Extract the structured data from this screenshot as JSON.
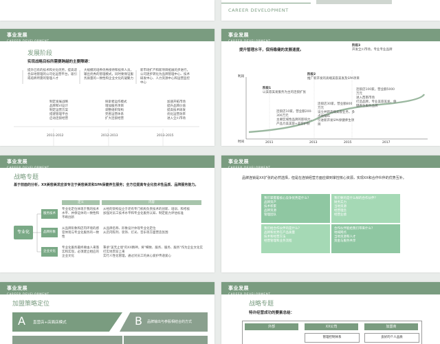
{
  "slide0": {
    "header_en": "CAREER DEVELOPMENT"
  },
  "common": {
    "title": "事业发展",
    "subtitle": "CAREER DEVELOPMENT"
  },
  "slide1": {
    "heading": "发展阶段",
    "intro": "实现战略目标所需要跨越的主要障碍：",
    "cols": [
      {
        "text": "提升已有的技术和文化优势，提高适合异地管理的公司化运营平台，吸引或培养所需的管理人才",
        "items": [
          "制定发展战略",
          "品牌和VI设计",
          "制定运营方案",
          "搭建管理平台",
          "启动连锁经营"
        ],
        "year": "2011-2012"
      },
      {
        "text": "大规模的培养优秀接待和技师人员，输出优秀的管理模式，同时要保证服务质量的一致性和企业文化的凝聚力",
        "items": [
          "探索者运作模式",
          "增加服务项目",
          "调整组织架构",
          "完善运营体系",
          "扩大连锁经营"
        ],
        "year": "2012-2013"
      },
      {
        "text": "新市场扩产和新项目拓展的步进行，公司逐步转化为品牌管理中心、技术研发中心、人力资源中心和运营监控中心",
        "items": [
          "加速开拓市场",
          "提升品牌价值",
          "提高技术研发",
          "优化运营效率",
          "进入全川市场"
        ],
        "year": "2013-2015"
      }
    ]
  },
  "slide2": {
    "intro": "提升管理水平，保持稳健的发展速度。",
    "ylabel": "利润",
    "xlabel": "时间",
    "years": [
      "2011",
      "2013",
      "2015",
      "2017"
    ],
    "stages": [
      {
        "title": "阶段1",
        "desc": "以美容美发服务为主的连锁扩张"
      },
      {
        "title": "阶段2",
        "desc": "推广新开发的高端美容美发及SPA项目"
      },
      {
        "title": "阶段3",
        "desc": "开发全川市场，专业专业品牌"
      }
    ],
    "notes": [
      [
        "连锁店10家，营业额200-300万元",
        "主要区域性品牌的影响力，产品力美美容+美容护肤"
      ],
      [
        "连锁店30家，营业额800万元",
        "设立并新高端美容业务，多点地铺布",
        "引进新开发SPA保健养生项目"
      ],
      [
        "连锁店100家，营业额5000万元",
        "进入西南市场",
        "打造品牌，专业美容美发，保健养生服务品牌"
      ]
    ]
  },
  "slide3": {
    "heading": "战略专题",
    "intro": "基于前面的分析，XX美容美发应该专注于美容美发和SPA保健养生服务；全方位提高专业化技术性品质、品牌服务能力。",
    "col_head1": "定义",
    "col_head2": "内容",
    "center": "专业化",
    "rows": [
      {
        "label": "服务技术",
        "def": "专业化定位体现于我的技术水平、并保证体的一致性和不断创新",
        "content": [
          "从经的架构设立于老有专门机构负责技术的创新、培训、和考核",
          "加强对员工技术水平和专业化服务认知、制定能力评估标准"
        ]
      },
      {
        "label": "品牌形象",
        "def": "从品牌形象和店内环境的感官体现与专业化服务的一致性",
        "content": [
          "从品牌名称、形象设计体现专业化定位",
          "从店内陈列、装饰、灯光、音乐等方面营造氛围"
        ]
      },
      {
        "label": "企业文化",
        "def": "专业化服务最终要由人来落实和实现，必须建立相应的企业文化",
        "content": [
          "秉承\"美无止境\"的XX精神，将\"细致、服务、服务、服务\"作为企业文化实打实地贯穿上来",
          "实行人性化管理，通过对员工的关心爱护传递爱心"
        ]
      }
    ]
  },
  "slide4": {
    "intro": "品牌连锁是XX扩张的必然选择，但是在连锁经营方面应做到掌控核心资源，实现XX和合作伙伴的优势互补。",
    "cells": [
      {
        "title": "我们掌握着核心竞争优势是什么？",
        "items": [
          "品牌资产",
          "技术积累",
          "品牌资源",
          "管理团队"
        ]
      },
      {
        "title": "我们要的是什么样的合作伙伴？",
        "items": [
          "财务实力",
          "当地资源",
          "经营理念",
          "经营业绩"
        ]
      },
      {
        "title": "我们给合作伙伴的是什么？",
        "items": [
          "品牌和优势在产品质量",
          "技术和经营方法",
          "经营管理和业务流程"
        ]
      },
      {
        "title": "合作伙伴能给我们带来什么？",
        "items": [
          "地域网点",
          "当地资源和人才",
          "资金与服务共享"
        ]
      }
    ]
  },
  "slide5": {
    "heading": "加盟策略定位",
    "items": [
      {
        "letter": "A",
        "text": "直营店+店面店模式"
      },
      {
        "letter": "B",
        "text": "品牌输出与参股相结合的方式"
      }
    ]
  },
  "slide6": {
    "heading": "战略专题",
    "intro": "特许经营成功的要素总结：",
    "cols": [
      "外部",
      "XX公司",
      "加盟商"
    ],
    "cells": [
      "",
      "管理控制体系",
      "良好的个人品质"
    ]
  }
}
